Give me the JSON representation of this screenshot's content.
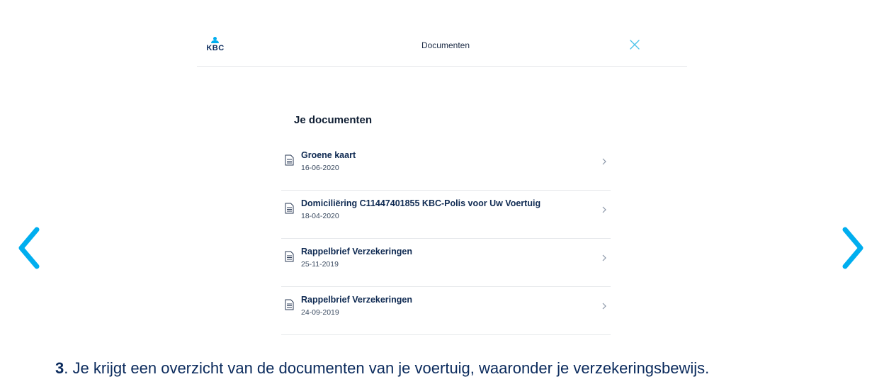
{
  "header": {
    "logo_text": "KBC",
    "title": "Documenten"
  },
  "section": {
    "title": "Je documenten"
  },
  "documents": [
    {
      "name": "Groene kaart",
      "date": "16-06-2020"
    },
    {
      "name": "Domiciliëring C11447401855 KBC-Polis voor Uw Voertuig",
      "date": "18-04-2020"
    },
    {
      "name": "Rappelbrief Verzekeringen",
      "date": "25-11-2019"
    },
    {
      "name": "Rappelbrief Verzekeringen",
      "date": "24-09-2019"
    }
  ],
  "caption": {
    "step": "3",
    "text": ". Je krijgt een overzicht van de documenten van je voertuig, waaronder je verzekeringsbewijs."
  },
  "colors": {
    "accent": "#00aeef",
    "navy": "#0a2a5c"
  },
  "icons": {
    "close": "close-icon",
    "document": "document-icon",
    "chevron": "chevron-right-icon",
    "prev": "arrow-left-icon",
    "next": "arrow-right-icon"
  }
}
